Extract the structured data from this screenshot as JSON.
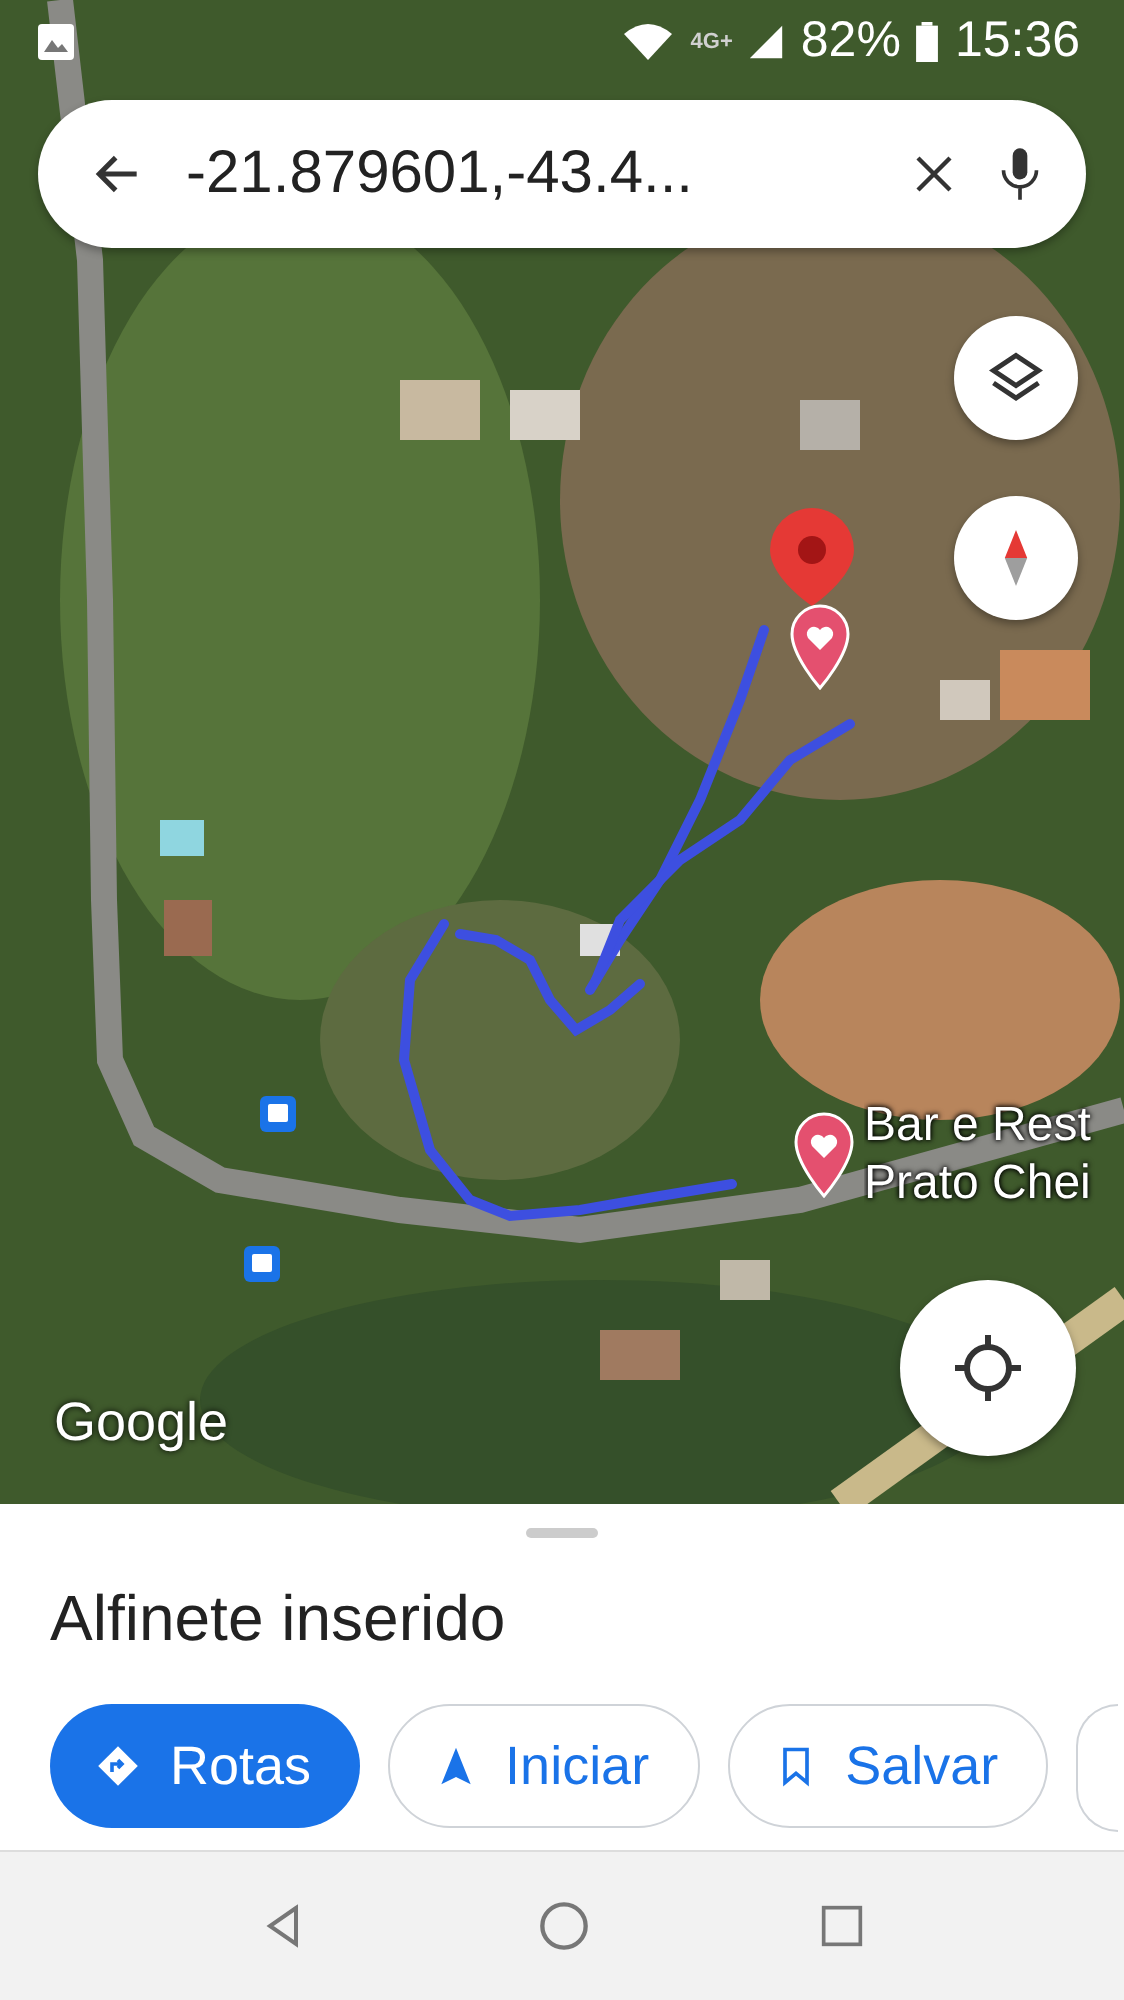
{
  "status_bar": {
    "network": "4G+",
    "battery": "82%",
    "time": "15:36"
  },
  "search": {
    "value": "-21.879601,-43.4..."
  },
  "map": {
    "logo": "Google",
    "place_label": {
      "lines": [
        "Bar e Rest",
        "Prato Chei"
      ]
    }
  },
  "sheet": {
    "title": "Alfinete inserido",
    "actions": [
      {
        "label": "Rotas",
        "kind": "primary"
      },
      {
        "label": "Iniciar",
        "kind": "outline"
      },
      {
        "label": "Salvar",
        "kind": "outline"
      }
    ]
  }
}
